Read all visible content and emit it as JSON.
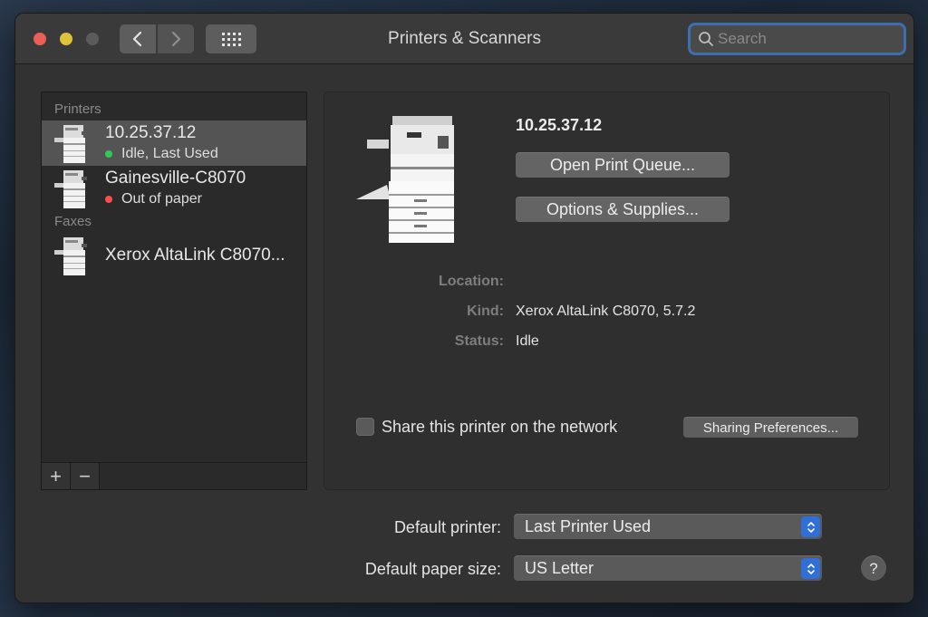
{
  "window": {
    "title": "Printers & Scanners",
    "search_placeholder": "Search"
  },
  "sidebar": {
    "printers_header": "Printers",
    "printers": [
      {
        "name": "10.25.37.12",
        "status": "Idle, Last Used",
        "status_color": "#35c759",
        "selected": true
      },
      {
        "name": "Gainesville-C8070",
        "status": "Out of paper",
        "status_color": "#ff4d4d",
        "selected": false
      }
    ],
    "faxes_header": "Faxes",
    "faxes": [
      {
        "name": "Xerox AltaLink C8070..."
      }
    ],
    "add_label": "+",
    "remove_label": "−"
  },
  "detail": {
    "printer_name": "10.25.37.12",
    "open_queue_label": "Open Print Queue...",
    "options_label": "Options & Supplies...",
    "location_label": "Location:",
    "location_value": "",
    "kind_label": "Kind:",
    "kind_value": "Xerox AltaLink C8070, 5.7.2",
    "status_label": "Status:",
    "status_value": "Idle",
    "share_label": "Share this printer on the network",
    "share_checked": false,
    "sharing_prefs_label": "Sharing Preferences..."
  },
  "defaults": {
    "printer_label": "Default printer:",
    "printer_value": "Last Printer Used",
    "paper_label": "Default paper size:",
    "paper_value": "US Letter",
    "help_label": "?"
  }
}
